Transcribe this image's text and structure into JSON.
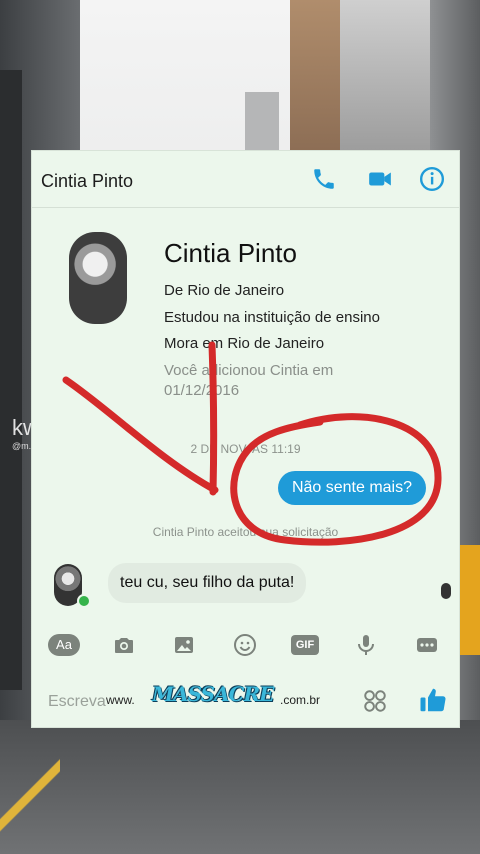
{
  "header": {
    "title": "Cintia Pinto",
    "icons": [
      "phone-icon",
      "video-icon",
      "info-icon"
    ],
    "accent": "#1f9bd8"
  },
  "profile": {
    "name": "Cintia Pinto",
    "from": "De Rio de Janeiro",
    "studied": "Estudou na instituição de ensino",
    "lives": "Mora em Rio de Janeiro",
    "added_line1": "Você adicionou Cintia em",
    "added_line2": "01/12/2016"
  },
  "conversation": {
    "timestamp": "2 DE NOV. ÀS 11:19",
    "outgoing_message": "Não sente mais?",
    "accepted_note": "Cintia Pinto aceitou sua solicitação",
    "incoming_message": "teu cu, seu filho da puta!"
  },
  "toolbar": {
    "aa_label": "Aa",
    "gif_label": "GIF",
    "icons": [
      "camera-icon",
      "image-icon",
      "emoji-icon",
      "gif-icon",
      "microphone-icon",
      "more-icon"
    ]
  },
  "composer": {
    "placeholder": "Escreva",
    "watermark_prefix": "www.",
    "watermark_logo": "MASSACRE",
    "watermark_suffix": ".com.br"
  },
  "overlay": {
    "watermark_brand": "kwai",
    "watermark_user": "@m...ial",
    "annotation_color": "#d42a2a"
  }
}
